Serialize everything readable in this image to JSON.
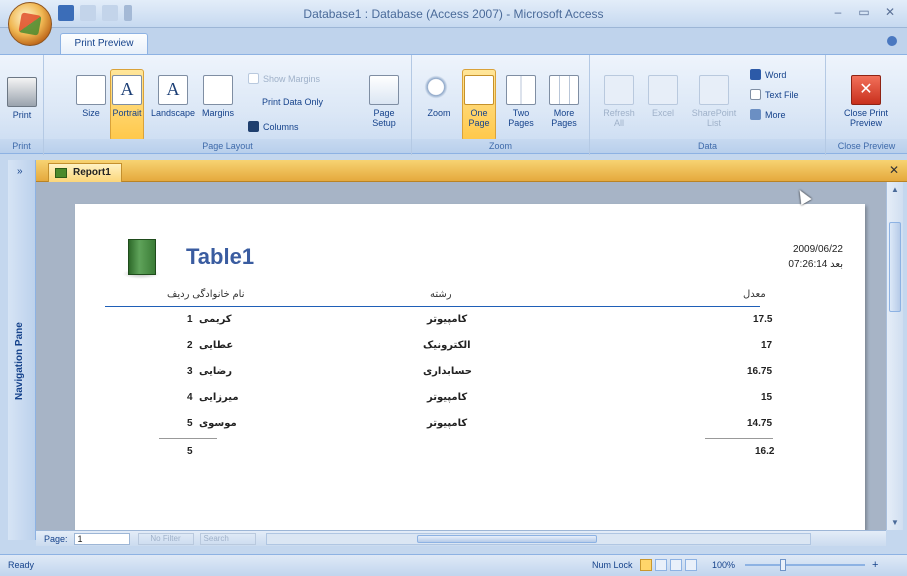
{
  "window": {
    "title": "Database1 : Database (Access 2007) - Microsoft Access",
    "controls": [
      "–",
      "▭",
      "✕"
    ]
  },
  "ribbon": {
    "tab": "Print Preview",
    "groups": {
      "print": {
        "label": "Print",
        "buttons": [
          {
            "label": "Print"
          }
        ]
      },
      "page_layout": {
        "label": "Page Layout",
        "buttons": [
          {
            "label": "Size"
          },
          {
            "label": "Portrait"
          },
          {
            "label": "Landscape"
          },
          {
            "label": "Margins"
          }
        ],
        "small": [
          {
            "label": "Show Margins"
          },
          {
            "label": "Print Data Only"
          },
          {
            "label": "Columns"
          }
        ],
        "page_setup": "Page Setup"
      },
      "zoom": {
        "label": "Zoom",
        "buttons": [
          {
            "label": "Zoom"
          },
          {
            "label": "One Page"
          },
          {
            "label": "Two Pages"
          },
          {
            "label": "More Pages"
          }
        ]
      },
      "data": {
        "label": "Data",
        "buttons": [
          {
            "label": "Refresh All"
          },
          {
            "label": "Excel"
          },
          {
            "label": "SharePoint List"
          }
        ],
        "small": [
          {
            "label": "Word"
          },
          {
            "label": "Text File"
          },
          {
            "label": "More"
          }
        ]
      },
      "close_preview": {
        "label": "Close Preview",
        "button": "Close Print Preview"
      }
    }
  },
  "document": {
    "tab": "Report1",
    "nav_pane_label": "Navigation Pane"
  },
  "report": {
    "title": "Table1",
    "date": "2009/06/22",
    "time": "07:26:14 بعد",
    "headers": {
      "id": "نام خانوادگی  ردیف",
      "major": "رشته",
      "grade": "معدل"
    },
    "rows": [
      {
        "id": "1",
        "name": "کریمی",
        "major": "کامپیوتر",
        "grade": "17.5"
      },
      {
        "id": "2",
        "name": "عطایی",
        "major": "الکترونیک",
        "grade": "17"
      },
      {
        "id": "3",
        "name": "رضایی",
        "major": "حسابداری",
        "grade": "16.75"
      },
      {
        "id": "4",
        "name": "میرزایی",
        "major": "کامپیوتر",
        "grade": "15"
      },
      {
        "id": "5",
        "name": "موسوی",
        "major": "کامپیوتر",
        "grade": "14.75"
      }
    ],
    "totals": {
      "count": "5",
      "avg": "16.2"
    }
  },
  "pagenav": {
    "label": "Page:",
    "value": "1",
    "filter": "No Filter",
    "search": "Search"
  },
  "status": {
    "left": "Ready",
    "numlock": "Num Lock",
    "zoom": "100%"
  }
}
